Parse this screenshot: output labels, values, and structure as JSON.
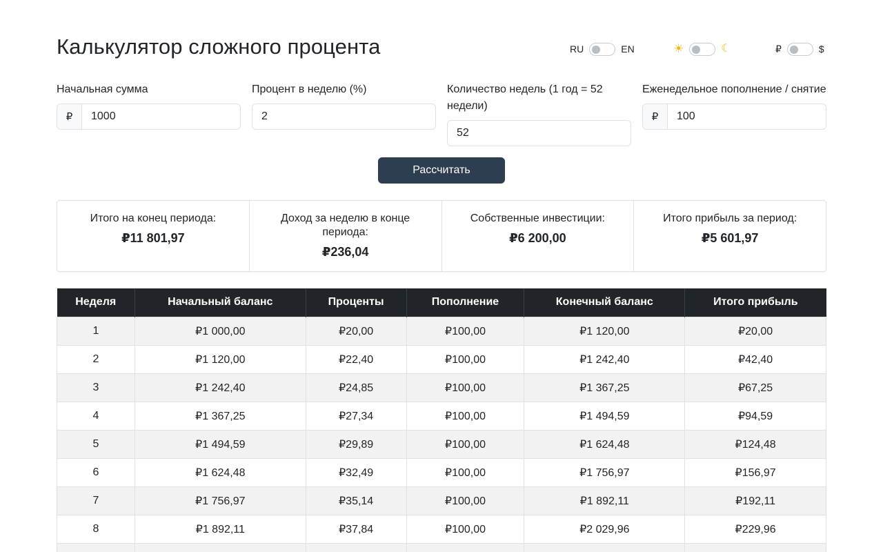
{
  "title": "Калькулятор сложного процента",
  "toggles": {
    "lang": {
      "left": "RU",
      "right": "EN"
    },
    "theme": {
      "left_icon": "sun-icon",
      "right_icon": "moon-icon"
    },
    "currency": {
      "left": "₽",
      "right": "$"
    }
  },
  "fields": {
    "initial": {
      "label": "Начальная сумма",
      "prefix": "₽",
      "value": "1000"
    },
    "percent": {
      "label": "Процент в неделю (%)",
      "value": "2"
    },
    "weeks": {
      "label": "Количество недель (1 год = 52 недели)",
      "value": "52"
    },
    "weekly": {
      "label": "Еженедельное пополнение / снятие",
      "prefix": "₽",
      "value": "100"
    }
  },
  "calc_button": "Рассчитать",
  "summary": [
    {
      "label": "Итого на конец периода:",
      "value": "₽11 801,97"
    },
    {
      "label": "Доход за неделю в конце периода:",
      "value": "₽236,04"
    },
    {
      "label": "Собственные инвестиции:",
      "value": "₽6 200,00"
    },
    {
      "label": "Итого прибыль за период:",
      "value": "₽5 601,97"
    }
  ],
  "table": {
    "headers": [
      "Неделя",
      "Начальный баланс",
      "Проценты",
      "Пополнение",
      "Конечный баланс",
      "Итого прибыль"
    ],
    "rows": [
      [
        "1",
        "₽1 000,00",
        "₽20,00",
        "₽100,00",
        "₽1 120,00",
        "₽20,00"
      ],
      [
        "2",
        "₽1 120,00",
        "₽22,40",
        "₽100,00",
        "₽1 242,40",
        "₽42,40"
      ],
      [
        "3",
        "₽1 242,40",
        "₽24,85",
        "₽100,00",
        "₽1 367,25",
        "₽67,25"
      ],
      [
        "4",
        "₽1 367,25",
        "₽27,34",
        "₽100,00",
        "₽1 494,59",
        "₽94,59"
      ],
      [
        "5",
        "₽1 494,59",
        "₽29,89",
        "₽100,00",
        "₽1 624,48",
        "₽124,48"
      ],
      [
        "6",
        "₽1 624,48",
        "₽32,49",
        "₽100,00",
        "₽1 756,97",
        "₽156,97"
      ],
      [
        "7",
        "₽1 756,97",
        "₽35,14",
        "₽100,00",
        "₽1 892,11",
        "₽192,11"
      ],
      [
        "8",
        "₽1 892,11",
        "₽37,84",
        "₽100,00",
        "₽2 029,96",
        "₽229,96"
      ],
      [
        "",
        "",
        "",
        "",
        "",
        ""
      ]
    ]
  }
}
